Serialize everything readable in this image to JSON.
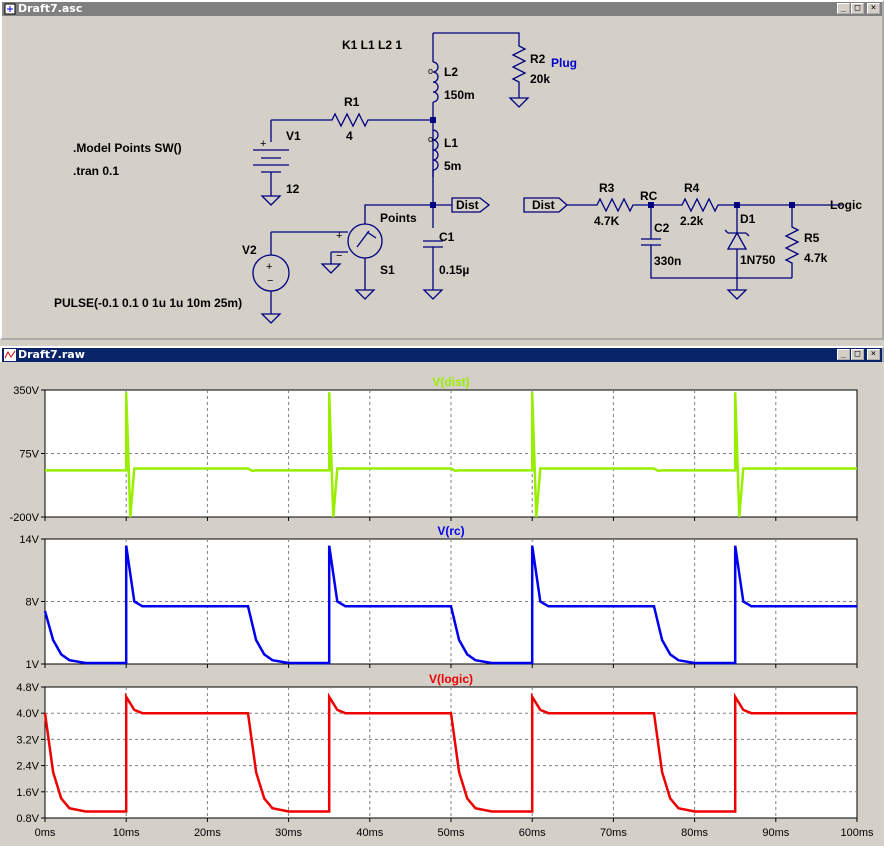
{
  "schematic_window": {
    "title": "Draft7.asc",
    "buttons": {
      "minimize": "_",
      "maximize": "□",
      "close": "×"
    },
    "directives": {
      "coupling": "K1 L1 L2 1",
      "model": ".Model Points SW()",
      "tran": ".tran 0.1"
    },
    "components": {
      "r2": {
        "name": "R2",
        "value": "20k"
      },
      "plug_label": "Plug",
      "l2": {
        "name": "L2",
        "value": "150m"
      },
      "r1": {
        "name": "R1",
        "value": "4"
      },
      "l1": {
        "name": "L1",
        "value": "5m"
      },
      "v1": {
        "name": "V1",
        "value": "12"
      },
      "c1": {
        "name": "C1",
        "value": "0.15µ"
      },
      "points_label": "Points",
      "s1": {
        "name": "S1"
      },
      "v2": {
        "name": "V2",
        "value": "PULSE(-0.1 0.1 0 1u 1u 10m 25m)"
      },
      "dist_out": "Dist",
      "dist_in": "Dist",
      "r3": {
        "name": "R3",
        "value": "4.7K"
      },
      "rc_label": "RC",
      "r4": {
        "name": "R4",
        "value": "2.2k"
      },
      "c2": {
        "name": "C2",
        "value": "330n"
      },
      "d1": {
        "name": "D1",
        "value": "1N750"
      },
      "r5": {
        "name": "R5",
        "value": "4.7k"
      },
      "logic_label": "Logic"
    }
  },
  "waveform_window": {
    "title": "Draft7.raw",
    "buttons": {
      "minimize": "_",
      "maximize": "□",
      "close": "×"
    }
  },
  "chart_data": [
    {
      "type": "line",
      "title": "V(dist)",
      "color": "#99ee00",
      "xlim": [
        0,
        100
      ],
      "ylim": [
        -200,
        350
      ],
      "yticks": [
        "350V",
        "75V",
        "-200V"
      ],
      "grid": true,
      "series": [
        {
          "name": "V(dist)",
          "x": [
            0,
            10,
            10,
            10.5,
            11,
            25,
            25.5,
            26,
            35,
            35,
            35.5,
            36,
            50,
            50.5,
            51,
            60,
            60,
            60.5,
            61,
            75,
            75.5,
            76,
            85,
            85,
            85.5,
            86,
            100
          ],
          "y": [
            2,
            2,
            340,
            -200,
            10,
            10,
            0,
            2,
            2,
            340,
            -200,
            10,
            10,
            0,
            2,
            2,
            340,
            -200,
            10,
            10,
            0,
            2,
            2,
            340,
            -200,
            10,
            10
          ]
        }
      ]
    },
    {
      "type": "line",
      "title": "V(rc)",
      "color": "#0000ee",
      "xlim": [
        0,
        100
      ],
      "ylim": [
        1,
        14
      ],
      "yticks": [
        "14V",
        "8V",
        "1V"
      ],
      "grid": true,
      "series": [
        {
          "name": "V(rc)",
          "x": [
            0,
            1,
            2,
            3,
            5,
            10,
            10,
            11,
            12,
            25,
            26,
            27,
            28,
            30,
            35,
            35,
            36,
            37,
            50,
            51,
            52,
            53,
            55,
            60,
            60,
            61,
            62,
            75,
            76,
            77,
            78,
            80,
            85,
            85,
            86,
            87,
            100
          ],
          "y": [
            6.5,
            3.5,
            2,
            1.4,
            1.1,
            1.1,
            13.3,
            7.5,
            7,
            7,
            3.5,
            2,
            1.4,
            1.1,
            1.1,
            13.3,
            7.5,
            7,
            7,
            3.5,
            2,
            1.4,
            1.1,
            1.1,
            13.3,
            7.5,
            7,
            7,
            3.5,
            2,
            1.4,
            1.1,
            1.1,
            13.3,
            7.5,
            7,
            7
          ]
        }
      ]
    },
    {
      "type": "line",
      "title": "V(logic)",
      "color": "#ee0000",
      "xlim": [
        0,
        100
      ],
      "ylim": [
        0.8,
        4.8
      ],
      "yticks": [
        "4.8V",
        "4.0V",
        "3.2V",
        "2.4V",
        "1.6V",
        "0.8V"
      ],
      "xticks": [
        "0ms",
        "10ms",
        "20ms",
        "30ms",
        "40ms",
        "50ms",
        "60ms",
        "70ms",
        "80ms",
        "90ms",
        "100ms"
      ],
      "grid": true,
      "series": [
        {
          "name": "V(logic)",
          "x": [
            0,
            1,
            2,
            3,
            5,
            10,
            10,
            11,
            12,
            25,
            26,
            27,
            28,
            30,
            35,
            35,
            36,
            37,
            50,
            51,
            52,
            53,
            55,
            60,
            60,
            61,
            62,
            75,
            76,
            77,
            78,
            80,
            85,
            85,
            86,
            87,
            100
          ],
          "y": [
            4.0,
            2.2,
            1.4,
            1.1,
            1.0,
            1.0,
            4.5,
            4.1,
            4.0,
            4.0,
            2.2,
            1.4,
            1.1,
            1.0,
            1.0,
            4.5,
            4.1,
            4.0,
            4.0,
            2.2,
            1.4,
            1.1,
            1.0,
            1.0,
            4.5,
            4.1,
            4.0,
            4.0,
            2.2,
            1.4,
            1.1,
            1.0,
            1.0,
            4.5,
            4.1,
            4.0,
            4.0
          ]
        }
      ]
    }
  ]
}
